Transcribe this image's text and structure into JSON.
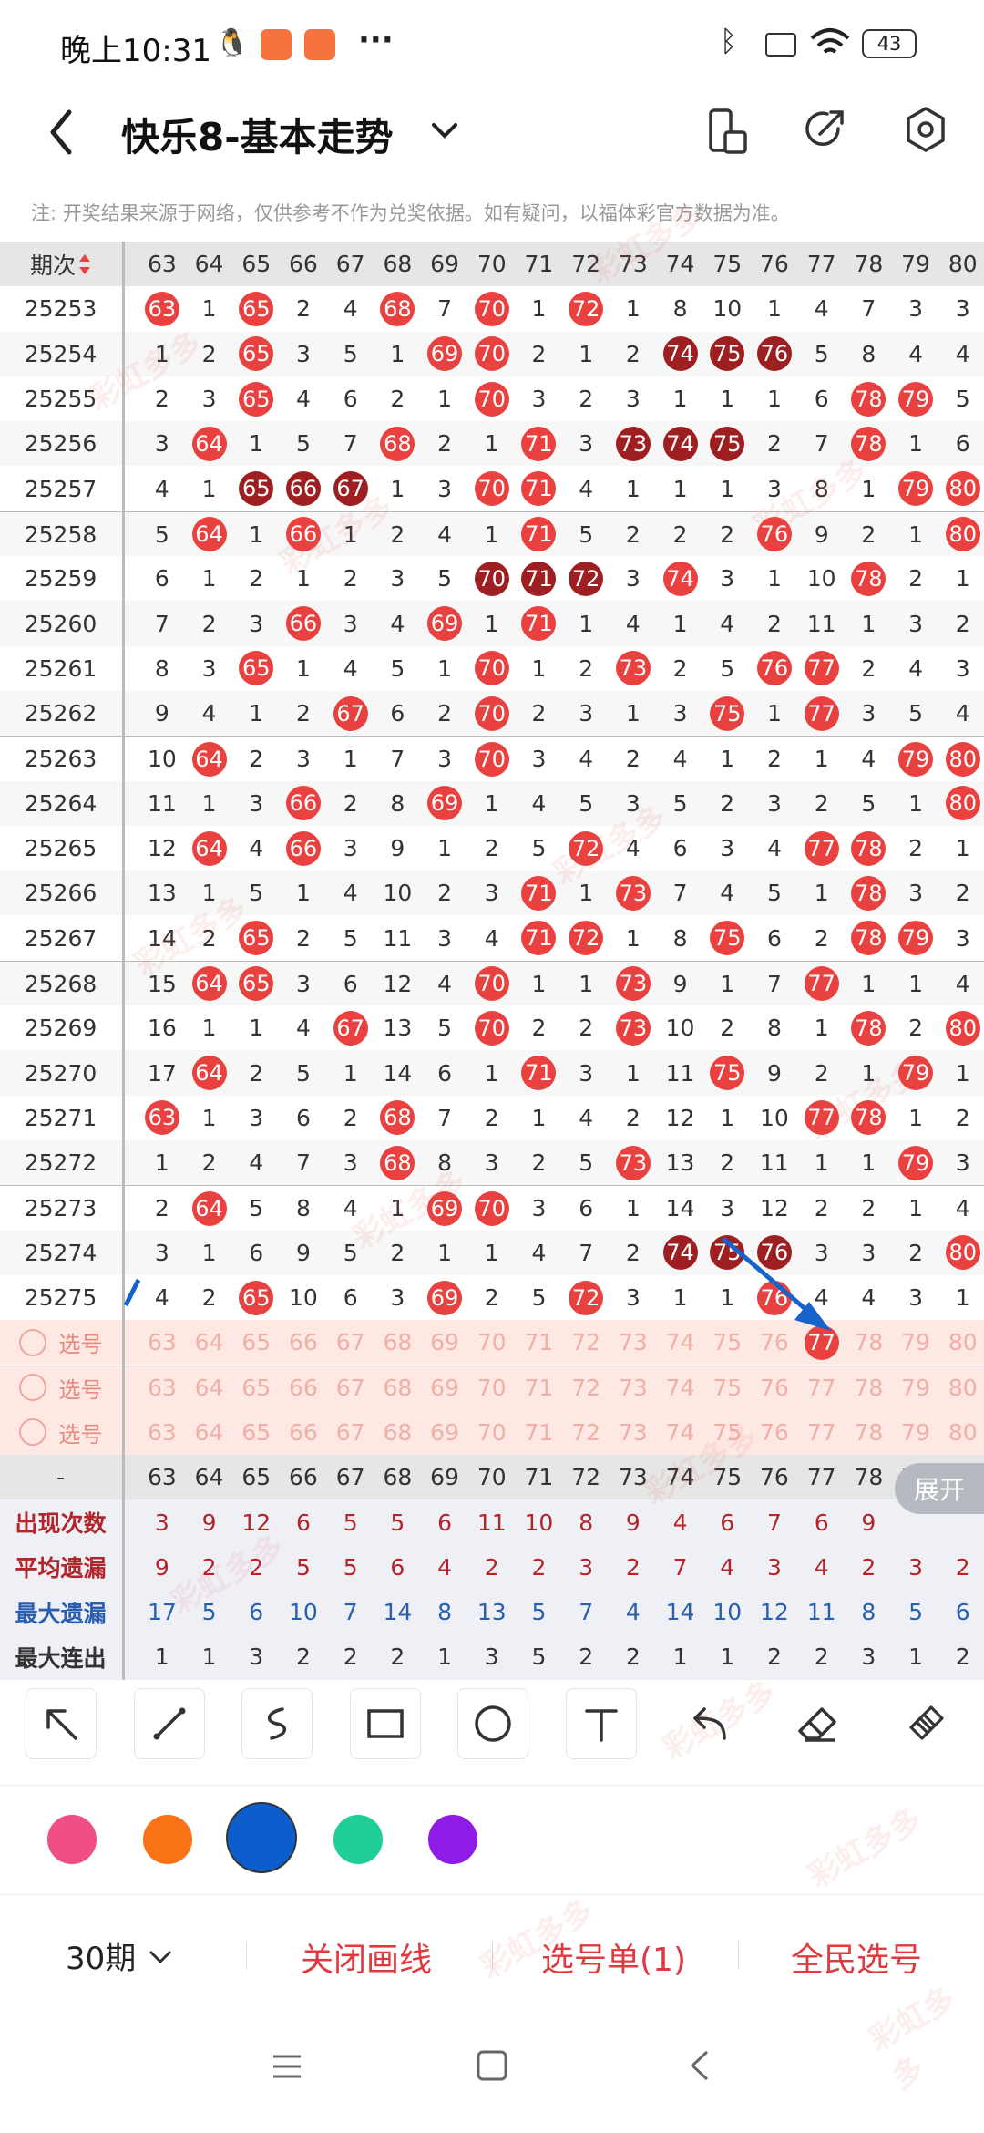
{
  "status": {
    "time": "晚上10:31",
    "battery": "43"
  },
  "header": {
    "title": "快乐8-基本走势"
  },
  "notice": "注: 开奖结果来源于网络，仅供参考不作为兑奖依据。如有疑问，以福体彩官方数据为准。",
  "table": {
    "period_header": "期次",
    "columns": [
      "63",
      "64",
      "65",
      "66",
      "67",
      "68",
      "69",
      "70",
      "71",
      "72",
      "73",
      "74",
      "75",
      "76",
      "77",
      "78",
      "79",
      "80"
    ],
    "rows": [
      {
        "p": "25253",
        "c": [
          [
            "63",
            "r"
          ],
          "1",
          [
            "65",
            "r"
          ],
          "2",
          "4",
          [
            "68",
            "r"
          ],
          "7",
          [
            "70",
            "r"
          ],
          "1",
          [
            "72",
            "r"
          ],
          "1",
          "8",
          "10",
          "1",
          "4",
          "7",
          "3",
          "3"
        ]
      },
      {
        "p": "25254",
        "c": [
          "1",
          "2",
          [
            "65",
            "r"
          ],
          "3",
          "5",
          "1",
          [
            "69",
            "r"
          ],
          [
            "70",
            "r"
          ],
          "2",
          "1",
          "2",
          [
            "74",
            "d"
          ],
          [
            "75",
            "d"
          ],
          [
            "76",
            "d"
          ],
          "5",
          "8",
          "4",
          "4"
        ]
      },
      {
        "p": "25255",
        "c": [
          "2",
          "3",
          [
            "65",
            "r"
          ],
          "4",
          "6",
          "2",
          "1",
          [
            "70",
            "r"
          ],
          "3",
          "2",
          "3",
          "1",
          "1",
          "1",
          "6",
          [
            "78",
            "r"
          ],
          [
            "79",
            "r"
          ],
          "5"
        ]
      },
      {
        "p": "25256",
        "c": [
          "3",
          [
            "64",
            "r"
          ],
          "1",
          "5",
          "7",
          [
            "68",
            "r"
          ],
          "2",
          "1",
          [
            "71",
            "r"
          ],
          "3",
          [
            "73",
            "d"
          ],
          [
            "74",
            "d"
          ],
          [
            "75",
            "d"
          ],
          "2",
          "7",
          [
            "78",
            "r"
          ],
          "1",
          "6"
        ]
      },
      {
        "p": "25257",
        "c": [
          "4",
          "1",
          [
            "65",
            "d"
          ],
          [
            "66",
            "d"
          ],
          [
            "67",
            "d"
          ],
          "1",
          "3",
          [
            "70",
            "r"
          ],
          [
            "71",
            "r"
          ],
          "4",
          "1",
          "1",
          "1",
          "3",
          "8",
          "1",
          [
            "79",
            "r"
          ],
          [
            "80",
            "r"
          ]
        ]
      },
      {
        "p": "25258",
        "c": [
          "5",
          [
            "64",
            "r"
          ],
          "1",
          [
            "66",
            "r"
          ],
          "1",
          "2",
          "4",
          "1",
          [
            "71",
            "r"
          ],
          "5",
          "2",
          "2",
          "2",
          [
            "76",
            "r"
          ],
          "9",
          "2",
          "1",
          [
            "80",
            "r"
          ]
        ]
      },
      {
        "p": "25259",
        "c": [
          "6",
          "1",
          "2",
          "1",
          "2",
          "3",
          "5",
          [
            "70",
            "d"
          ],
          [
            "71",
            "d"
          ],
          [
            "72",
            "d"
          ],
          "3",
          [
            "74",
            "r"
          ],
          "3",
          "1",
          "10",
          [
            "78",
            "r"
          ],
          "2",
          "1"
        ]
      },
      {
        "p": "25260",
        "c": [
          "7",
          "2",
          "3",
          [
            "66",
            "r"
          ],
          "3",
          "4",
          [
            "69",
            "r"
          ],
          "1",
          [
            "71",
            "r"
          ],
          "1",
          "4",
          "1",
          "4",
          "2",
          "11",
          "1",
          "3",
          "2"
        ]
      },
      {
        "p": "25261",
        "c": [
          "8",
          "3",
          [
            "65",
            "r"
          ],
          "1",
          "4",
          "5",
          "1",
          [
            "70",
            "r"
          ],
          "1",
          "2",
          [
            "73",
            "r"
          ],
          "2",
          "5",
          [
            "76",
            "r"
          ],
          [
            "77",
            "r"
          ],
          "2",
          "4",
          "3"
        ]
      },
      {
        "p": "25262",
        "c": [
          "9",
          "4",
          "1",
          "2",
          [
            "67",
            "r"
          ],
          "6",
          "2",
          [
            "70",
            "r"
          ],
          "2",
          "3",
          "1",
          "3",
          [
            "75",
            "r"
          ],
          "1",
          [
            "77",
            "r"
          ],
          "3",
          "5",
          "4"
        ]
      },
      {
        "p": "25263",
        "c": [
          "10",
          [
            "64",
            "r"
          ],
          "2",
          "3",
          "1",
          "7",
          "3",
          [
            "70",
            "r"
          ],
          "3",
          "4",
          "2",
          "4",
          "1",
          "2",
          "1",
          "4",
          [
            "79",
            "r"
          ],
          [
            "80",
            "r"
          ]
        ]
      },
      {
        "p": "25264",
        "c": [
          "11",
          "1",
          "3",
          [
            "66",
            "r"
          ],
          "2",
          "8",
          [
            "69",
            "r"
          ],
          "1",
          "4",
          "5",
          "3",
          "5",
          "2",
          "3",
          "2",
          "5",
          "1",
          [
            "80",
            "r"
          ]
        ]
      },
      {
        "p": "25265",
        "c": [
          "12",
          [
            "64",
            "r"
          ],
          "4",
          [
            "66",
            "r"
          ],
          "3",
          "9",
          "1",
          "2",
          "5",
          [
            "72",
            "r"
          ],
          "4",
          "6",
          "3",
          "4",
          [
            "77",
            "r"
          ],
          [
            "78",
            "r"
          ],
          "2",
          "1"
        ]
      },
      {
        "p": "25266",
        "c": [
          "13",
          "1",
          "5",
          "1",
          "4",
          "10",
          "2",
          "3",
          [
            "71",
            "r"
          ],
          "1",
          [
            "73",
            "r"
          ],
          "7",
          "4",
          "5",
          "1",
          [
            "78",
            "r"
          ],
          "3",
          "2"
        ]
      },
      {
        "p": "25267",
        "c": [
          "14",
          "2",
          [
            "65",
            "r"
          ],
          "2",
          "5",
          "11",
          "3",
          "4",
          [
            "71",
            "r"
          ],
          [
            "72",
            "r"
          ],
          "1",
          "8",
          [
            "75",
            "r"
          ],
          "6",
          "2",
          [
            "78",
            "r"
          ],
          [
            "79",
            "r"
          ],
          "3"
        ]
      },
      {
        "p": "25268",
        "c": [
          "15",
          [
            "64",
            "r"
          ],
          [
            "65",
            "r"
          ],
          "3",
          "6",
          "12",
          "4",
          [
            "70",
            "r"
          ],
          "1",
          "1",
          [
            "73",
            "r"
          ],
          "9",
          "1",
          "7",
          [
            "77",
            "r"
          ],
          "1",
          "1",
          "4"
        ]
      },
      {
        "p": "25269",
        "c": [
          "16",
          "1",
          "1",
          "4",
          [
            "67",
            "r"
          ],
          "13",
          "5",
          [
            "70",
            "r"
          ],
          "2",
          "2",
          [
            "73",
            "r"
          ],
          "10",
          "2",
          "8",
          "1",
          [
            "78",
            "r"
          ],
          "2",
          [
            "80",
            "r"
          ]
        ]
      },
      {
        "p": "25270",
        "c": [
          "17",
          [
            "64",
            "r"
          ],
          "2",
          "5",
          "1",
          "14",
          "6",
          "1",
          [
            "71",
            "r"
          ],
          "3",
          "1",
          "11",
          [
            "75",
            "r"
          ],
          "9",
          "2",
          "1",
          [
            "79",
            "r"
          ],
          "1"
        ]
      },
      {
        "p": "25271",
        "c": [
          [
            "63",
            "r"
          ],
          "1",
          "3",
          "6",
          "2",
          [
            "68",
            "r"
          ],
          "7",
          "2",
          "1",
          "4",
          "2",
          "12",
          "1",
          "10",
          [
            "77",
            "r"
          ],
          [
            "78",
            "r"
          ],
          "1",
          "2"
        ]
      },
      {
        "p": "25272",
        "c": [
          "1",
          "2",
          "4",
          "7",
          "3",
          [
            "68",
            "r"
          ],
          "8",
          "3",
          "2",
          "5",
          [
            "73",
            "r"
          ],
          "13",
          "2",
          "11",
          "1",
          "1",
          [
            "79",
            "r"
          ],
          "3"
        ]
      },
      {
        "p": "25273",
        "c": [
          "2",
          [
            "64",
            "r"
          ],
          "5",
          "8",
          "4",
          "1",
          [
            "69",
            "r"
          ],
          [
            "70",
            "r"
          ],
          "3",
          "6",
          "1",
          "14",
          "3",
          "12",
          "2",
          "2",
          "1",
          "4"
        ]
      },
      {
        "p": "25274",
        "c": [
          "3",
          "1",
          "6",
          "9",
          "5",
          "2",
          "1",
          "1",
          "4",
          "7",
          "2",
          [
            "74",
            "d"
          ],
          [
            "75",
            "d"
          ],
          [
            "76",
            "d"
          ],
          "3",
          "3",
          "2",
          [
            "80",
            "r"
          ]
        ]
      },
      {
        "p": "25275",
        "c": [
          "4",
          "2",
          [
            "65",
            "r"
          ],
          "10",
          "6",
          "3",
          [
            "69",
            "r"
          ],
          "2",
          "5",
          [
            "72",
            "r"
          ],
          "3",
          "1",
          "1",
          [
            "76",
            "r"
          ],
          "4",
          "4",
          "3",
          "1"
        ]
      }
    ],
    "pick_label": "选号",
    "stats": [
      {
        "label": "出现次数",
        "color": "#b0262a",
        "values": [
          "3",
          "9",
          "12",
          "6",
          "5",
          "5",
          "6",
          "11",
          "10",
          "8",
          "9",
          "4",
          "6",
          "7",
          "6",
          "9",
          "",
          ""
        ]
      },
      {
        "label": "平均遗漏",
        "color": "#b0262a",
        "values": [
          "9",
          "2",
          "2",
          "5",
          "5",
          "6",
          "4",
          "2",
          "2",
          "3",
          "2",
          "7",
          "4",
          "3",
          "4",
          "2",
          "3",
          "2"
        ]
      },
      {
        "label": "最大遗漏",
        "color": "#2a5fb0",
        "values": [
          "17",
          "5",
          "6",
          "10",
          "7",
          "14",
          "8",
          "13",
          "5",
          "7",
          "4",
          "14",
          "10",
          "12",
          "11",
          "8",
          "5",
          "6"
        ]
      },
      {
        "label": "最大连出",
        "color": "#333333",
        "values": [
          "1",
          "1",
          "3",
          "2",
          "2",
          "2",
          "1",
          "3",
          "5",
          "2",
          "2",
          "1",
          "1",
          "2",
          "2",
          "3",
          "1",
          "2"
        ]
      }
    ],
    "expand_label": "展开",
    "dash": "-"
  },
  "toolbar": {
    "tools": [
      "arrow-tool-icon",
      "line-tool-icon",
      "curve-tool-icon",
      "rectangle-tool-icon",
      "circle-tool-icon",
      "text-tool-icon",
      "undo-icon",
      "eraser-icon",
      "clear-all-icon"
    ],
    "colors": [
      "#ef4f86",
      "#f97316",
      "#0b5ecb",
      "#1fcf98",
      "#8e1be6"
    ],
    "selected_color": 2
  },
  "bottom": {
    "period_select": "30期",
    "close_draw": "关闭画线",
    "pick_list": "选号单(1)",
    "all_pick": "全民选号"
  },
  "watermark": "彩虹多多"
}
